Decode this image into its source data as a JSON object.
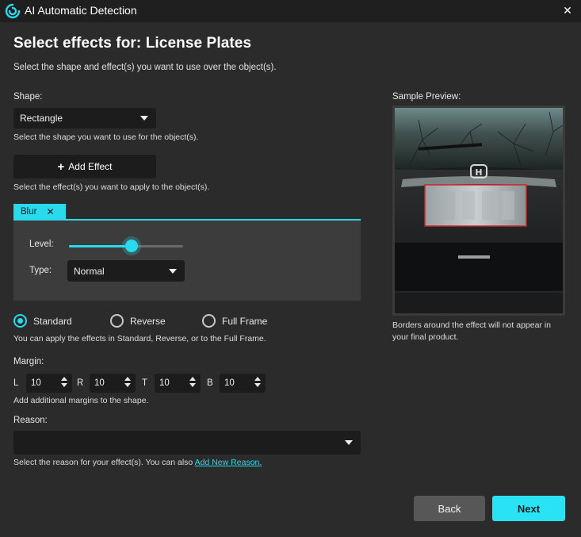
{
  "window": {
    "title": "AI Automatic Detection",
    "close_symbol": "✕"
  },
  "heading": "Select effects for: License Plates",
  "subtitle": "Select the shape and effect(s) you want to use over the object(s).",
  "shape": {
    "label": "Shape:",
    "selected": "Rectangle",
    "hint": "Select the shape you want to use for the object(s)."
  },
  "add_effect": {
    "label": "Add Effect",
    "hint": "Select the effect(s) you want to apply to the object(s)."
  },
  "effect_tab": {
    "label": "Blur",
    "close_symbol": "✕"
  },
  "effect_panel": {
    "level_label": "Level:",
    "level_value": 0.55,
    "type_label": "Type:",
    "type_selected": "Normal"
  },
  "modes": {
    "options": [
      {
        "label": "Standard",
        "checked": true
      },
      {
        "label": "Reverse",
        "checked": false
      },
      {
        "label": "Full Frame",
        "checked": false
      }
    ],
    "hint": "You can apply the effects in Standard, Reverse, or to the Full Frame."
  },
  "margin": {
    "label": "Margin:",
    "fields": [
      {
        "letter": "L",
        "value": "10"
      },
      {
        "letter": "R",
        "value": "10"
      },
      {
        "letter": "T",
        "value": "10"
      },
      {
        "letter": "B",
        "value": "10"
      }
    ],
    "hint": "Add additional margins to the shape."
  },
  "reason": {
    "label": "Reason:",
    "selected": "",
    "hint": "Select the reason for your effect(s). You can also ",
    "link": "Add New Reason."
  },
  "preview": {
    "label": "Sample Preview:",
    "caption": "Borders around the effect will not appear in your final product."
  },
  "buttons": {
    "back": "Back",
    "next": "Next"
  },
  "colors": {
    "accent": "#29d9ec",
    "background": "#2b2b2b",
    "titlebar": "#1f1f1f"
  }
}
